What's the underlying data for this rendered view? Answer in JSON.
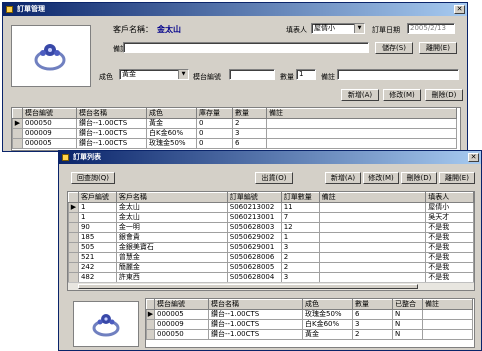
{
  "order_window": {
    "title": "訂單管理",
    "customer_label": "客戶名稱：",
    "customer_value": "金太山",
    "filler_label": "填表人",
    "filler_value": "屋倩小",
    "order_date_label": "訂單日期",
    "order_date_value": "2005/2/13",
    "remark_label": "備註：",
    "save_button": "儲存(S)",
    "leave_button": "離開(E)",
    "color_label": "成色",
    "color_value": "黃金",
    "model_label": "模台編號",
    "qty_label": "數量",
    "qty_value": "1",
    "remark2_label": "備註",
    "add_button": "新增(A)",
    "edit_button": "修改(M)",
    "delete_button": "刪除(D)",
    "table": {
      "columns": [
        "模台編號",
        "模台名稱",
        "成色",
        "庫存量",
        "數量",
        "備註"
      ],
      "rows": [
        [
          "000050",
          "鑽台--1.00CTS",
          "黃金",
          "0",
          "2",
          ""
        ],
        [
          "000009",
          "鑽台--1.00CTS",
          "白K金60%",
          "0",
          "3",
          ""
        ],
        [
          "000005",
          "鑽台--1.00CTS",
          "玫瑰金50%",
          "0",
          "6",
          ""
        ]
      ]
    }
  },
  "list_window": {
    "title": "訂單列表",
    "back_button": "回查詢(Q)",
    "ship_button": "出貨(O)",
    "add_button": "新增(A)",
    "edit_button": "修改(M)",
    "delete_button": "刪除(D)",
    "leave_button": "離開(E)",
    "table": {
      "columns": [
        "客戶編號",
        "客戶名稱",
        "訂單編號",
        "訂單數量",
        "備註",
        "填表人"
      ],
      "rows": [
        [
          "1",
          "金太山",
          "S060213002",
          "11",
          "",
          "屋倩小"
        ],
        [
          "1",
          "金太山",
          "S060213001",
          "7",
          "",
          "吳天才"
        ],
        [
          "90",
          "金一明",
          "S050628003",
          "12",
          "",
          "不是我"
        ],
        [
          "185",
          "銀會貴",
          "S050629002",
          "1",
          "",
          "不是我"
        ],
        [
          "505",
          "金銀美寶石",
          "S050629001",
          "3",
          "",
          "不是我"
        ],
        [
          "521",
          "曾慧金",
          "S050628006",
          "2",
          "",
          "不是我"
        ],
        [
          "242",
          "簡麗金",
          "S050628005",
          "2",
          "",
          "不是我"
        ],
        [
          "482",
          "許東西",
          "S050628004",
          "3",
          "",
          "不是我"
        ]
      ]
    },
    "detail_table": {
      "columns": [
        "模台編號",
        "模台名稱",
        "成色",
        "數量",
        "已整合",
        "備註"
      ],
      "rows": [
        [
          "000005",
          "鑽台--1.00CTS",
          "玫瑰金50%",
          "6",
          "N",
          ""
        ],
        [
          "000009",
          "鑽台--1.00CTS",
          "白K金60%",
          "3",
          "N",
          ""
        ],
        [
          "000050",
          "鑽台--1.00CTS",
          "黃金",
          "2",
          "N",
          ""
        ]
      ]
    }
  },
  "colors": {
    "title_start": "#0a246a",
    "title_end": "#a6caf0",
    "window_face": "#d4d0c8",
    "customer_name": "#00008b"
  }
}
